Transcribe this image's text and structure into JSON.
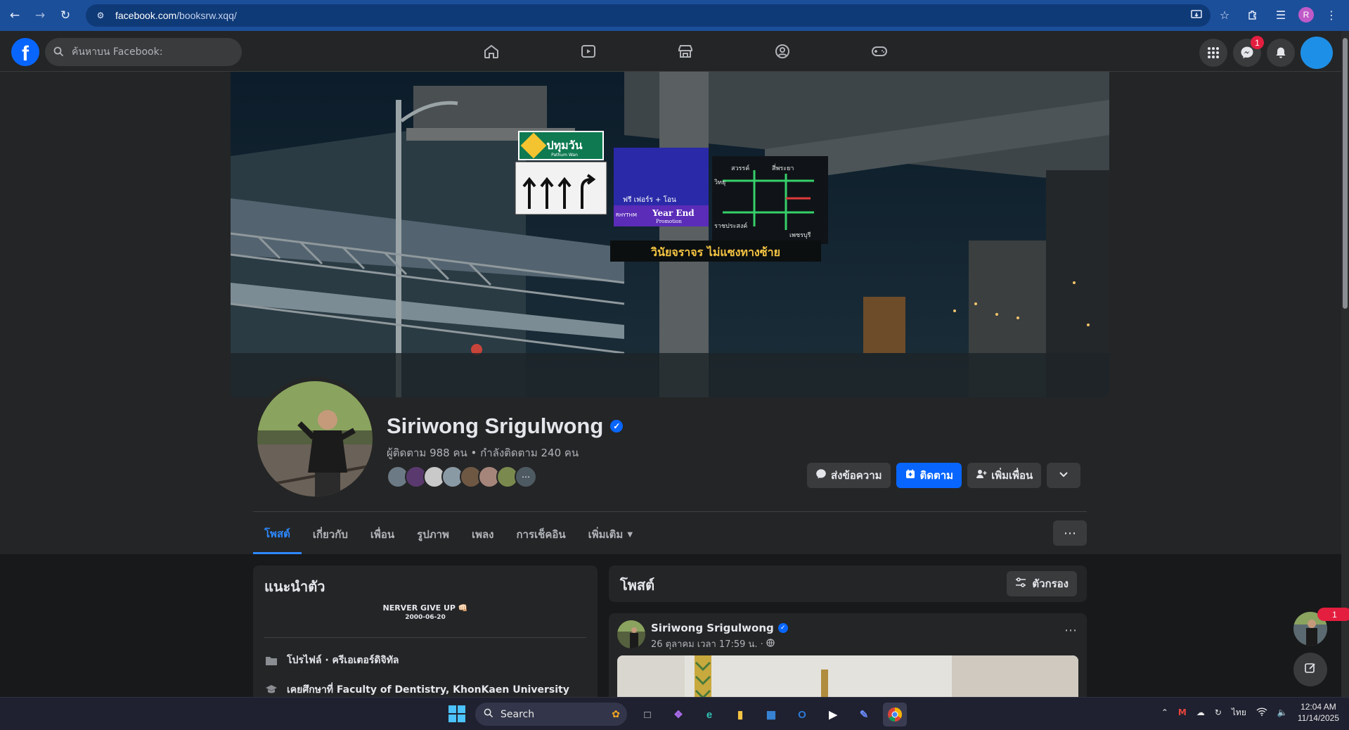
{
  "browser": {
    "url_domain": "facebook.com",
    "url_path": "/booksrw.xqq/",
    "profile_initial": "R"
  },
  "fb": {
    "logo": "f",
    "search_placeholder": "ค้นหาบน Facebook:",
    "messenger_badge": "1"
  },
  "profile": {
    "name": "Siriwong Srigulwong",
    "stats": "ผู้ติดตาม 988 คน • กำลังติดตาม 240 คน",
    "actions": {
      "message": "ส่งข้อความ",
      "follow": "ติดตาม",
      "add_friend": "เพิ่มเพื่อน"
    },
    "tabs": [
      "โพสต์",
      "เกี่ยวกับ",
      "เพื่อน",
      "รูปภาพ",
      "เพลง",
      "การเช็คอิน",
      "เพิ่มเติม"
    ]
  },
  "cover_signs": {
    "pathum": "ปทุมวัน",
    "pathum_en": "Pathum Wan",
    "yearend": "Year End",
    "promotion": "Promotion",
    "free": "ฟรี เฟอร์ร + โอน",
    "rhythm": "RHYTHM",
    "discipline": "วินัยจราจร ไม่แซงทางซ้าย",
    "sawat": "สวรรค์",
    "siphaya": "สี่พระยา",
    "witthayu": "วิทยุ",
    "ratchaprasong": "ราชประสงค์",
    "phetchaburi": "เพชรบุรี"
  },
  "intro": {
    "title": "แนะนำตัว",
    "bio_line1": "NERVER GIVE UP 👊🏻",
    "bio_line2": "2000-06-20",
    "rows": [
      "โปรไฟล์ · ครีเอเตอร์ดิจิทัล",
      "เคยศึกษาที่ Faculty of Dentistry, KhonKaen University"
    ]
  },
  "posts": {
    "title": "โพสต์",
    "filter": "ตัวกรอง",
    "author": "Siriwong Srigulwong",
    "meta": "26 ตุลาคม เวลา 17:59 น. ·"
  },
  "float": {
    "badge": "1"
  },
  "taskbar": {
    "search": "Search",
    "lang": "ไทย",
    "time": "12:04 AM",
    "date": "11/14/2025"
  },
  "colors": {
    "fb_blue": "#0866ff",
    "active_tab": "#2d88ff",
    "badge_red": "#e41e3f",
    "page_bg": "#18191a",
    "surface": "#242526"
  }
}
